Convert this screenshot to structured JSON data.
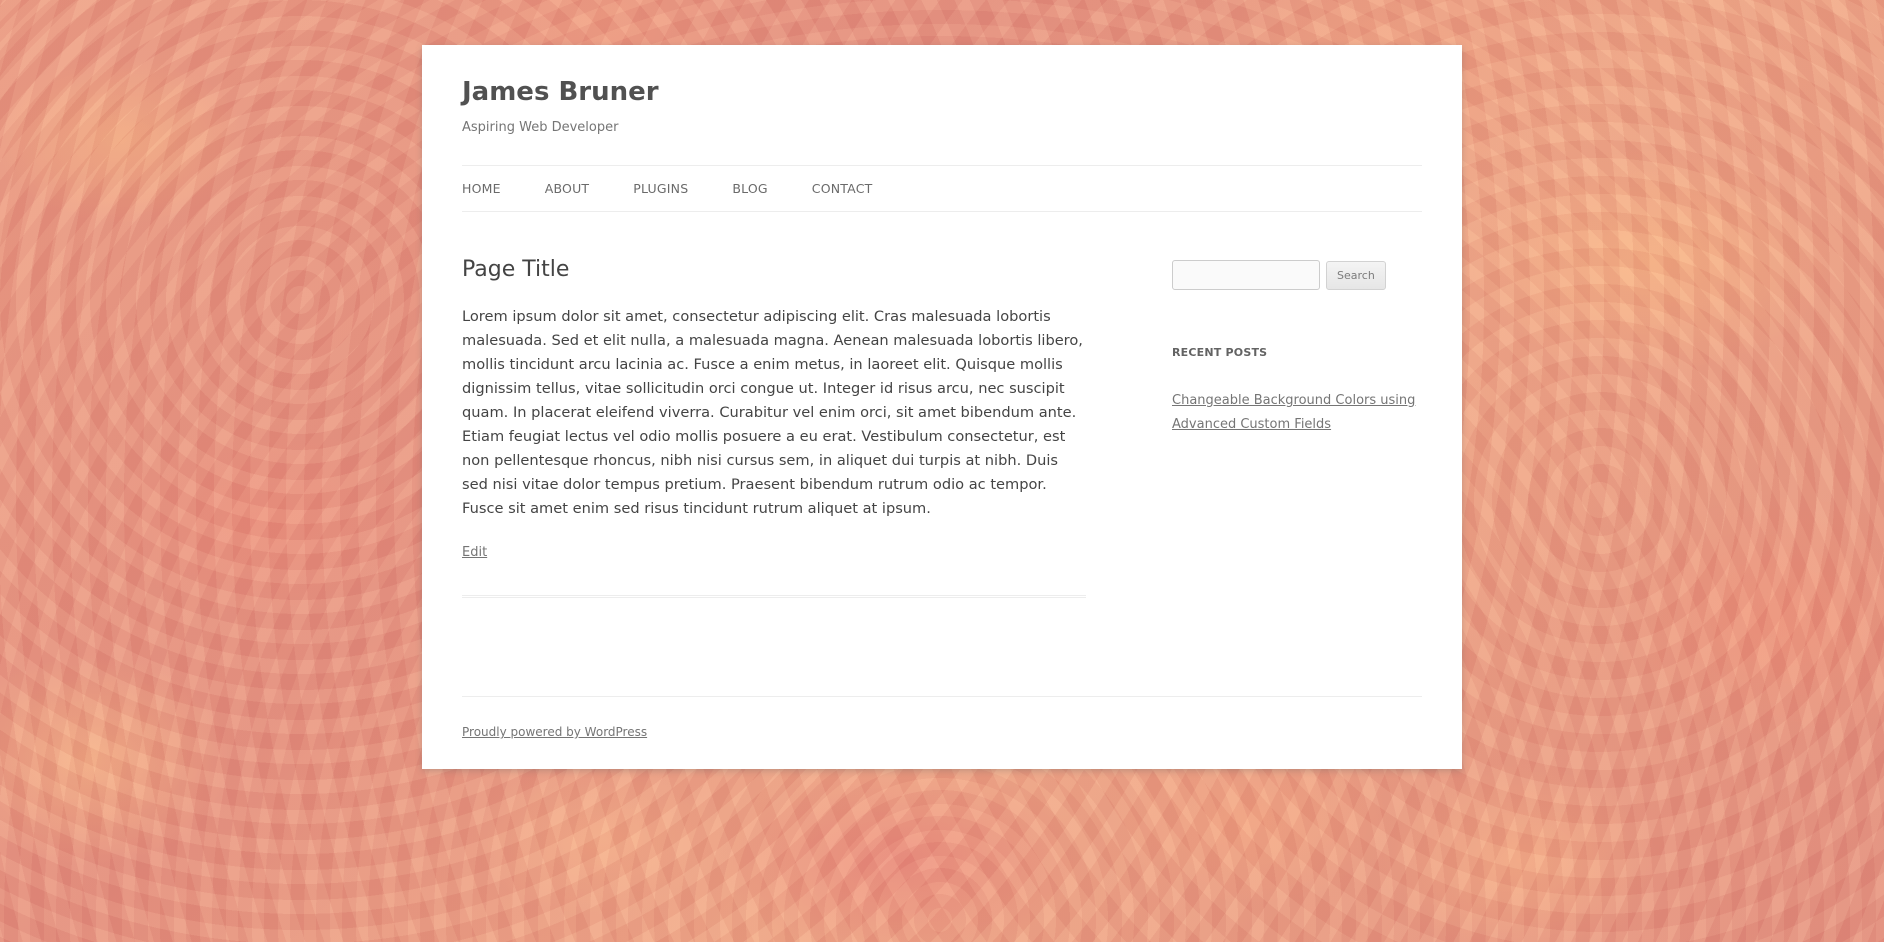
{
  "site": {
    "title": "James Bruner",
    "description": "Aspiring Web Developer"
  },
  "nav": {
    "items": [
      "HOME",
      "ABOUT",
      "PLUGINS",
      "BLOG",
      "CONTACT"
    ]
  },
  "page": {
    "title": "Page Title",
    "body": "Lorem ipsum dolor sit amet, consectetur adipiscing elit. Cras malesuada lobortis malesuada. Sed et elit nulla, a malesuada magna. Aenean malesuada lobortis libero, mollis tincidunt arcu lacinia ac. Fusce a enim metus, in laoreet elit. Quisque mollis dignissim tellus, vitae sollicitudin orci congue ut. Integer id risus arcu, nec suscipit quam. In placerat eleifend viverra. Curabitur vel enim orci, sit amet bibendum ante. Etiam feugiat lectus vel odio mollis posuere a eu erat. Vestibulum consectetur, est non pellentesque rhoncus, nibh nisi cursus sem, in aliquet dui turpis at nibh. Duis sed nisi vitae dolor tempus pretium. Praesent bibendum rutrum odio ac tempor. Fusce sit amet enim sed risus tincidunt rutrum aliquet at ipsum.",
    "edit_label": "Edit"
  },
  "sidebar": {
    "search": {
      "value": "",
      "button_label": "Search"
    },
    "recent_posts": {
      "title": "RECENT POSTS",
      "items": [
        "Changeable Background Colors using Advanced Custom Fields"
      ]
    }
  },
  "footer": {
    "credit": "Proudly powered by WordPress"
  }
}
